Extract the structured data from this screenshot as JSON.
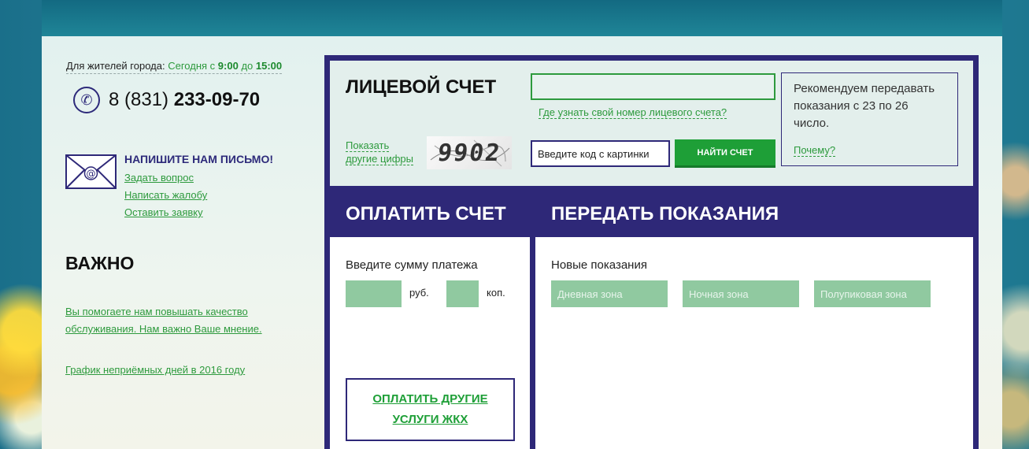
{
  "contacts": {
    "hours_prefix": "Для жителей города:",
    "hours_today": "Сегодня с",
    "hours_from": "9:00",
    "hours_to_word": "до",
    "hours_to": "15:00",
    "phone_code": "8 (831)",
    "phone_number": "233-09-70"
  },
  "mail": {
    "title": "НАПИШИТЕ НАМ ПИСЬМО!",
    "links": [
      "Задать вопрос",
      "Написать жалобу",
      "Оставить заявку"
    ]
  },
  "important": {
    "title": "ВАЖНО",
    "feedback_link": "Вы помогаете нам повышать качество обслуживания. Нам важно Ваше мнение.",
    "schedule_link": "График неприёмных дней в 2016 году"
  },
  "account": {
    "title": "ЛИЦЕВОЙ СЧЕТ",
    "account_input_value": "",
    "where_link": "Где узнать свой номер лицевого счета?",
    "show_other_digits": "Показать другие цифры",
    "captcha_code": "9902",
    "code_placeholder": "Введите код с картинки",
    "find_button": "НАЙТИ СЧЕТ",
    "recommend_text": "Рекомендуем передавать показания с 23 по 26 число.",
    "why_link": "Почему?"
  },
  "pay": {
    "title": "ОПЛАТИТЬ СЧЕТ",
    "sum_label": "Введите сумму платежа",
    "rub_label": "руб.",
    "kop_label": "коп.",
    "other_button": "ОПЛАТИТЬ ДРУГИЕ УСЛУГИ ЖКХ"
  },
  "meters": {
    "title": "ПЕРЕДАТЬ ПОКАЗАНИЯ",
    "new_readings_label": "Новые показания",
    "zones": [
      "Дневная зона",
      "Ночная зона",
      "Полупиковая зона"
    ]
  },
  "colors": {
    "brand_navy": "#2e2878",
    "accent_green": "#1e9f37",
    "field_green": "#90c9a0"
  },
  "icons": {
    "phone": "phone-icon",
    "mail": "envelope-icon"
  }
}
